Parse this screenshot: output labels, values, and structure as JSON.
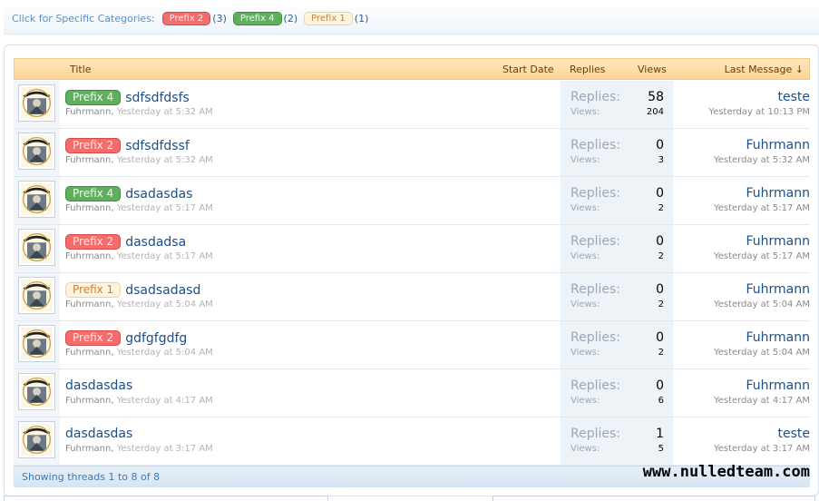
{
  "category_bar": {
    "label": "Click for Specific Categories:",
    "items": [
      {
        "label": "Prefix 2",
        "count": "(3)",
        "style": "red"
      },
      {
        "label": "Prefix 4",
        "count": "(2)",
        "style": "green"
      },
      {
        "label": "Prefix 1",
        "count": "(1)",
        "style": "beige"
      }
    ]
  },
  "table": {
    "headers": {
      "title": "Title",
      "start_date": "Start Date",
      "replies": "Replies",
      "views": "Views",
      "last_message": "Last Message ↓"
    },
    "stat_labels": {
      "replies": "Replies:",
      "views": "Views:"
    },
    "rows": [
      {
        "prefix": "Prefix 4",
        "prefix_style": "green",
        "title": "sdfsdfdsfs",
        "author": "Fuhrmann,",
        "time": "Yesterday at 5:32 AM",
        "replies": "58",
        "views": "204",
        "last_user": "teste",
        "last_time": "Yesterday at 10:13 PM"
      },
      {
        "prefix": "Prefix 2",
        "prefix_style": "red",
        "title": "sdfsdfdssf",
        "author": "Fuhrmann,",
        "time": "Yesterday at 5:32 AM",
        "replies": "0",
        "views": "3",
        "last_user": "Fuhrmann",
        "last_time": "Yesterday at 5:32 AM"
      },
      {
        "prefix": "Prefix 4",
        "prefix_style": "green",
        "title": "dsadasdas",
        "author": "Fuhrmann,",
        "time": "Yesterday at 5:17 AM",
        "replies": "0",
        "views": "2",
        "last_user": "Fuhrmann",
        "last_time": "Yesterday at 5:17 AM"
      },
      {
        "prefix": "Prefix 2",
        "prefix_style": "red",
        "title": "dasdadsa",
        "author": "Fuhrmann,",
        "time": "Yesterday at 5:17 AM",
        "replies": "0",
        "views": "2",
        "last_user": "Fuhrmann",
        "last_time": "Yesterday at 5:17 AM"
      },
      {
        "prefix": "Prefix 1",
        "prefix_style": "beige",
        "title": "dsadsadasd",
        "author": "Fuhrmann,",
        "time": "Yesterday at 5:04 AM",
        "replies": "0",
        "views": "2",
        "last_user": "Fuhrmann",
        "last_time": "Yesterday at 5:04 AM"
      },
      {
        "prefix": "Prefix 2",
        "prefix_style": "red",
        "title": "gdfgfgdfg",
        "author": "Fuhrmann,",
        "time": "Yesterday at 5:04 AM",
        "replies": "0",
        "views": "2",
        "last_user": "Fuhrmann",
        "last_time": "Yesterday at 5:04 AM"
      },
      {
        "prefix": "",
        "prefix_style": "",
        "title": "dasdasdas",
        "author": "Fuhrmann,",
        "time": "Yesterday at 4:17 AM",
        "replies": "0",
        "views": "6",
        "last_user": "Fuhrmann",
        "last_time": "Yesterday at 4:17 AM"
      },
      {
        "prefix": "",
        "prefix_style": "",
        "title": "dasdasdas",
        "author": "Fuhrmann,",
        "time": "Yesterday at 3:17 AM",
        "replies": "1",
        "views": "5",
        "last_user": "teste",
        "last_time": "Yesterday at 3:17 AM"
      }
    ],
    "footer": "Showing threads 1 to 8 of 8"
  },
  "watermark": "www.nulledteam.com",
  "colors": {
    "link": "#1c4f86",
    "header_bg": "#fbd599",
    "prefix_red": "#f26d6d",
    "prefix_green": "#5faf5f",
    "prefix_beige": "#fff4df"
  }
}
